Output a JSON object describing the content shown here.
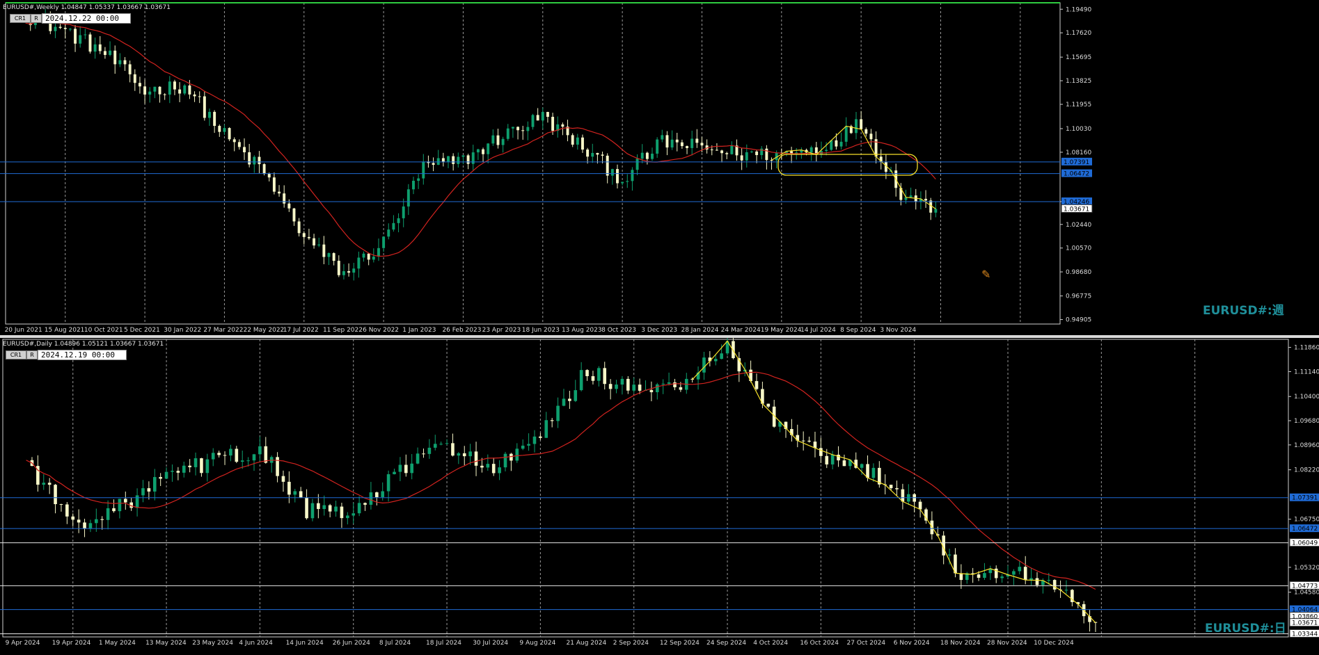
{
  "colors": {
    "background": "#000000",
    "bull": "#0e9f6e",
    "bear": "#f7f7c8",
    "ma": "#d2231f",
    "hline": "#1f6bd6",
    "hline_white": "#e8e8e8",
    "annotation": "#f5e02a",
    "grid": "#9a9a9a",
    "axis_text": "#dcdcdc",
    "price_tag_blue": "#1f6bd6",
    "price_tag_white": "#ffffff",
    "watermark": "#1f8f9a"
  },
  "weekly": {
    "header": "EURUSD#,Weekly  1.04847 1.05337 1.03667 1.03671",
    "date_field": "2024.12.22 00:00",
    "btn_cr": "CR1",
    "btn_r": "R",
    "watermark": "EURUSD#:週"
  },
  "daily": {
    "header": "EURUSD#,Daily  1.04896 1.05121 1.03667 1.03671",
    "date_field": "2024.12.19 00:00",
    "btn_cr": "CR1",
    "btn_r": "R",
    "watermark": "EURUSD#:日"
  },
  "chart_data": [
    {
      "type": "candlestick",
      "timeframe": "Weekly",
      "symbol": "EURUSD#",
      "y_ticks": [
        1.1949,
        1.1762,
        1.15695,
        1.13825,
        1.11955,
        1.1003,
        1.0816,
        1.04246,
        1.0244,
        1.0057,
        0.9868,
        0.96775,
        0.94905
      ],
      "y_tick_labels": [
        "1.19490",
        "1.17620",
        "1.15695",
        "1.13825",
        "1.11955",
        "1.10030",
        "1.08160",
        "1.04246",
        "1.02440",
        "1.00570",
        "0.98680",
        "0.96775",
        "0.94905"
      ],
      "ylim": [
        0.9455,
        1.2
      ],
      "x_labels": [
        "20 Jun 2021",
        "15 Aug 2021",
        "10 Oct 2021",
        "5 Dec 2021",
        "30 Jan 2022",
        "27 Mar 2022",
        "22 May 2022",
        "17 Jul 2022",
        "11 Sep 2022",
        "6 Nov 2022",
        "1 Jan 2023",
        "26 Feb 2023",
        "23 Apr 2023",
        "18 Jun 2023",
        "13 Aug 2023",
        "8 Oct 2023",
        "3 Dec 2023",
        "28 Jan 2024",
        "24 Mar 2024",
        "19 May 2024",
        "14 Jul 2024",
        "8 Sep 2024",
        "3 Nov 2024"
      ],
      "close_path_anchors": [
        [
          "20 Jun 2021",
          1.19
        ],
        [
          "15 Aug 2021",
          1.178
        ],
        [
          "10 Oct 2021",
          1.16
        ],
        [
          "5 Dec 2021",
          1.13
        ],
        [
          "30 Jan 2022",
          1.135
        ],
        [
          "27 Mar 2022",
          1.095
        ],
        [
          "22 May 2022",
          1.065
        ],
        [
          "17 Jul 2022",
          1.015
        ],
        [
          "11 Sep 2022",
          0.985
        ],
        [
          "6 Nov 2022",
          1.01
        ],
        [
          "1 Jan 2023",
          1.07
        ],
        [
          "26 Feb 2023",
          1.075
        ],
        [
          "23 Apr 2023",
          1.095
        ],
        [
          "18 Jun 2023",
          1.11
        ],
        [
          "13 Aug 2023",
          1.085
        ],
        [
          "8 Oct 2023",
          1.06
        ],
        [
          "3 Dec 2023",
          1.09
        ],
        [
          "28 Jan 2024",
          1.085
        ],
        [
          "24 Mar 2024",
          1.08
        ],
        [
          "19 May 2024",
          1.08
        ],
        [
          "14 Jul 2024",
          1.085
        ],
        [
          "8 Sep 2024",
          1.105
        ],
        [
          "3 Nov 2024",
          1.05
        ],
        [
          "22 Dec 2024",
          1.0367
        ]
      ],
      "horizontal_lines": [
        {
          "value": 1.07391,
          "label": "1.07391",
          "color": "blue"
        },
        {
          "value": 1.06472,
          "label": "1.06472",
          "color": "blue"
        },
        {
          "value": 1.04246,
          "label": "1.04246",
          "color": "blue"
        }
      ],
      "current_price": {
        "value": 1.03671,
        "label": "1.03671"
      },
      "annotations": [
        "yellow rounded rectangle around Feb–Jul 2024 range",
        "yellow zigzag line on recent swings"
      ]
    },
    {
      "type": "candlestick",
      "timeframe": "Daily",
      "symbol": "EURUSD#",
      "y_ticks": [
        1.1186,
        1.1114,
        1.104,
        1.0968,
        1.0896,
        1.0822,
        1.0675,
        1.0532,
        1.0458
      ],
      "y_tick_labels": [
        "1.11860",
        "1.11140",
        "1.10400",
        "1.09680",
        "1.08960",
        "1.08220",
        "1.06750",
        "1.05320",
        "1.04580"
      ],
      "ylim": [
        1.0325,
        1.121
      ],
      "x_labels": [
        "9 Apr 2024",
        "19 Apr 2024",
        "1 May 2024",
        "13 May 2024",
        "23 May 2024",
        "4 Jun 2024",
        "14 Jun 2024",
        "26 Jun 2024",
        "8 Jul 2024",
        "18 Jul 2024",
        "30 Jul 2024",
        "9 Aug 2024",
        "21 Aug 2024",
        "2 Sep 2024",
        "12 Sep 2024",
        "24 Sep 2024",
        "4 Oct 2024",
        "16 Oct 2024",
        "27 Oct 2024",
        "6 Nov 2024",
        "18 Nov 2024",
        "28 Nov 2024",
        "10 Dec 2024"
      ],
      "close_path_anchors": [
        [
          "9 Apr 2024",
          1.085
        ],
        [
          "19 Apr 2024",
          1.066
        ],
        [
          "1 May 2024",
          1.071
        ],
        [
          "13 May 2024",
          1.08
        ],
        [
          "23 May 2024",
          1.085
        ],
        [
          "4 Jun 2024",
          1.088
        ],
        [
          "14 Jun 2024",
          1.07
        ],
        [
          "26 Jun 2024",
          1.069
        ],
        [
          "8 Jul 2024",
          1.082
        ],
        [
          "18 Jul 2024",
          1.09
        ],
        [
          "30 Jul 2024",
          1.082
        ],
        [
          "9 Aug 2024",
          1.092
        ],
        [
          "21 Aug 2024",
          1.112
        ],
        [
          "2 Sep 2024",
          1.105
        ],
        [
          "12 Sep 2024",
          1.108
        ],
        [
          "24 Sep 2024",
          1.118
        ],
        [
          "4 Oct 2024",
          1.097
        ],
        [
          "16 Oct 2024",
          1.085
        ],
        [
          "27 Oct 2024",
          1.082
        ],
        [
          "6 Nov 2024",
          1.073
        ],
        [
          "18 Nov 2024",
          1.05
        ],
        [
          "28 Nov 2024",
          1.052
        ],
        [
          "10 Dec 2024",
          1.048
        ],
        [
          "19 Dec 2024",
          1.0367
        ]
      ],
      "horizontal_lines": [
        {
          "value": 1.07391,
          "label": "1.07391",
          "color": "blue"
        },
        {
          "value": 1.06472,
          "label": "1.06472",
          "color": "blue"
        },
        {
          "value": 1.06049,
          "label": "1.06049",
          "color": "white"
        },
        {
          "value": 1.04773,
          "label": "1.04773",
          "color": "white"
        },
        {
          "value": 1.04064,
          "label": "1.04064",
          "color": "blue"
        },
        {
          "value": 1.03344,
          "label": "1.03344",
          "color": "white"
        }
      ],
      "extra_price_labels": [
        {
          "value": 1.0386,
          "label": "1.03860"
        }
      ],
      "current_price": {
        "value": 1.03671,
        "label": "1.03671"
      },
      "annotations": [
        "yellow zigzag line on swings Sep–Dec 2024"
      ]
    }
  ]
}
